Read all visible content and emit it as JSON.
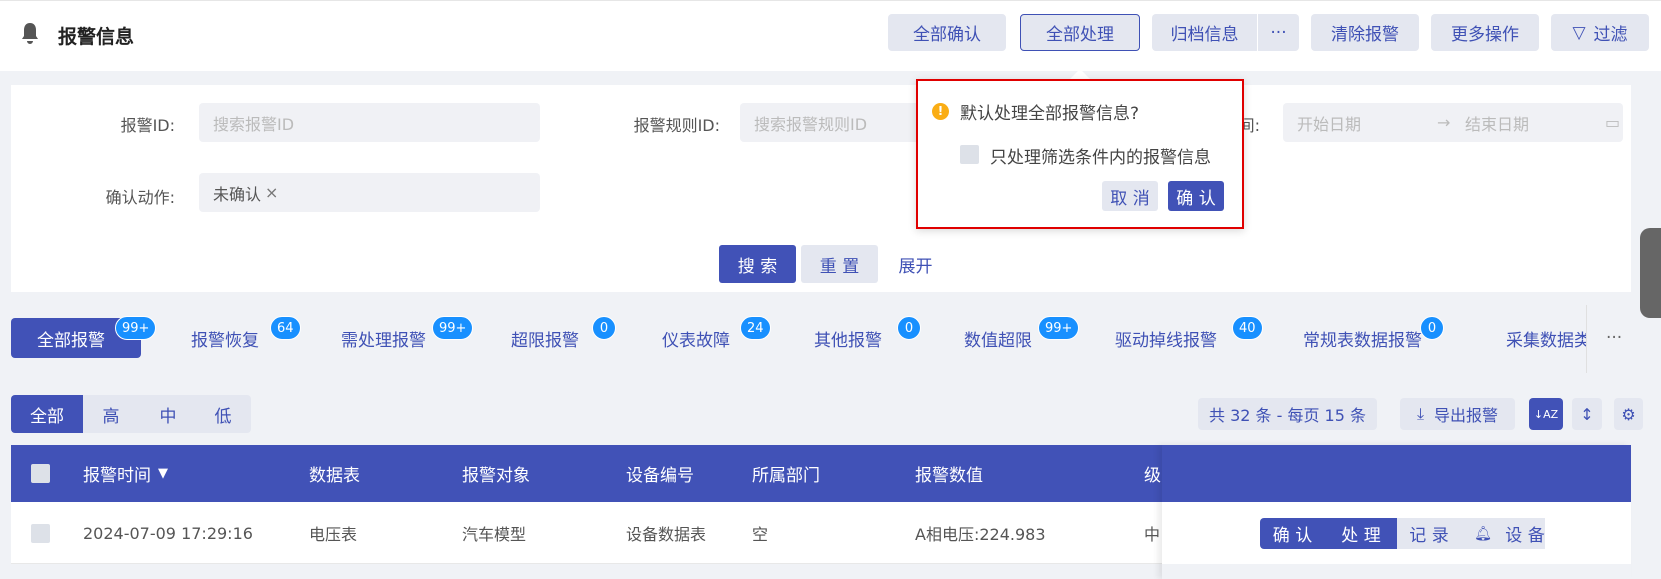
{
  "header": {
    "title": "报警信息",
    "icon": "bell-icon",
    "buttons": {
      "confirm_all": "全部确认",
      "process_all": "全部处理",
      "archive": "归档信息",
      "archive_more": "···",
      "clear": "清除报警",
      "more": "更多操作",
      "filter": "过滤"
    }
  },
  "filters": {
    "alarm_id": {
      "label": "报警ID:",
      "placeholder": "搜索报警ID"
    },
    "rule_id": {
      "label": "报警规则ID:",
      "placeholder": "搜索报警规则ID"
    },
    "time": {
      "label": "间:",
      "start_placeholder": "开始日期",
      "separator": "→",
      "end_placeholder": "结束日期"
    },
    "confirm_action": {
      "label": "确认动作:",
      "tag": "未确认",
      "tag_close": "×"
    },
    "search": "搜 索",
    "reset": "重 置",
    "expand": "展开"
  },
  "popconfirm": {
    "title": "默认处理全部报警信息?",
    "checkbox_label": "只处理筛选条件内的报警信息",
    "checked": false,
    "cancel": "取 消",
    "ok": "确 认"
  },
  "tabs": [
    {
      "label": "全部报警",
      "badge": "99+",
      "active": true
    },
    {
      "label": "报警恢复",
      "badge": "64"
    },
    {
      "label": "需处理报警",
      "badge": "99+"
    },
    {
      "label": "超限报警",
      "badge": "0"
    },
    {
      "label": "仪表故障",
      "badge": "24"
    },
    {
      "label": "其他报警",
      "badge": "0"
    },
    {
      "label": "数值超限",
      "badge": "99+"
    },
    {
      "label": "驱动掉线报警",
      "badge": "40"
    },
    {
      "label": "常规表数据报警",
      "badge": "0"
    },
    {
      "label": "采集数据类"
    }
  ],
  "tabs_more": "···",
  "levels": [
    "全部",
    "高",
    "中",
    "低"
  ],
  "toolbar": {
    "summary": "共 32 条 - 每页 15 条",
    "export": "导出报警"
  },
  "table": {
    "columns": [
      "报警时间",
      "数据表",
      "报警对象",
      "设备编号",
      "所属部门",
      "报警数值",
      "级"
    ],
    "sort_indicator": "▼",
    "rows": [
      {
        "time": "2024-07-09 17:29:16",
        "table": "电压表",
        "target": "汽车模型",
        "device_no": "设备数据表",
        "dept": "空",
        "value": "A相电压:224.983",
        "level": "中"
      }
    ],
    "actions": [
      "确 认",
      "处 理",
      "记 录",
      "设 备"
    ]
  },
  "colors": {
    "primary": "#4152b7",
    "badge": "#1890ff",
    "highlight": "#e00000"
  }
}
